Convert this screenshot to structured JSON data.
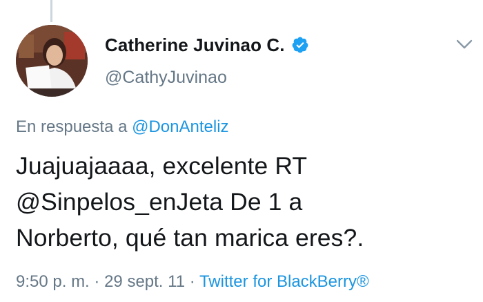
{
  "author": {
    "display_name": "Catherine Juvinao C.",
    "handle": "@CathyJuvinao",
    "verified": true
  },
  "reply": {
    "prefix": "En respuesta a",
    "mention": "@DonAnteliz"
  },
  "tweet": {
    "lines": [
      "Juajuajaaaa, excelente RT",
      "@Sinpelos_enJeta De 1 a",
      "Norberto, qué tan marica eres?."
    ]
  },
  "meta": {
    "time": "9:50 p. m.",
    "separator": "·",
    "date": "29 sept. 11",
    "source": "Twitter for BlackBerry®"
  },
  "colors": {
    "accent": "#1b95e0",
    "secondary_text": "#657786",
    "primary_text": "#14171a"
  },
  "icons": {
    "verified": "verified-badge-icon",
    "caret": "chevron-down-icon"
  }
}
